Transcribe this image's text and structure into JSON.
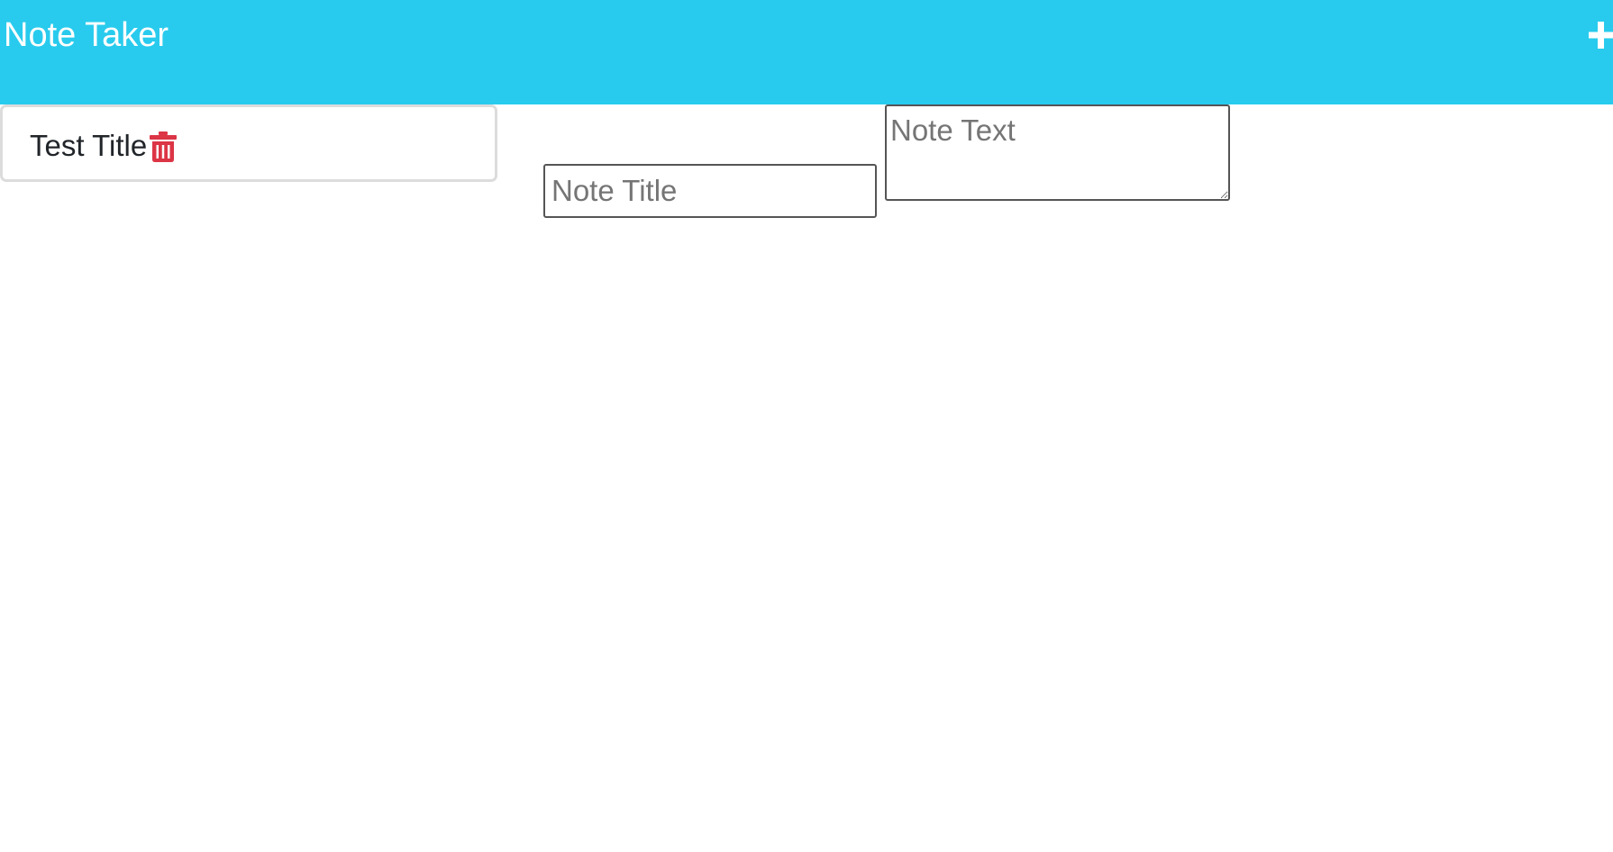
{
  "navbar": {
    "title": "Note Taker",
    "background_color": "#28cbed",
    "add_icon": "plus-icon"
  },
  "notes": [
    {
      "title": "Test Title",
      "delete_icon": "trash-icon",
      "delete_icon_color": "#dc3545"
    }
  ],
  "editor": {
    "title_placeholder": "Note Title",
    "title_value": "",
    "text_placeholder": "Note Text",
    "text_value": ""
  }
}
